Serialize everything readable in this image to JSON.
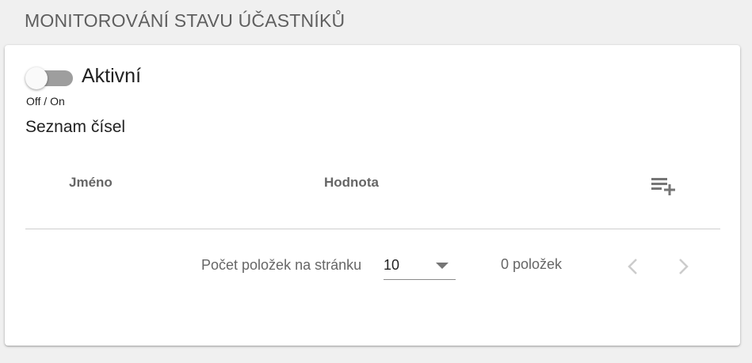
{
  "header": {
    "title": "MONITOROVÁNÍ STAVU ÚČASTNÍKŮ"
  },
  "toggle": {
    "label": "Aktivní",
    "hint": "Off / On",
    "checked": false
  },
  "numbers_section": {
    "title": "Seznam čísel"
  },
  "table": {
    "columns": [
      "Jméno",
      "Hodnota"
    ],
    "rows": [],
    "add_icon": "playlist-add-icon"
  },
  "paginator": {
    "items_per_page_label": "Počet položek na stránku",
    "page_size": "10",
    "range_label": "0 položek",
    "prev_icon": "chevron-left-icon",
    "next_icon": "chevron-right-icon"
  },
  "colors": {
    "background": "#f0f0f0",
    "card": "#ffffff",
    "toggle_track": "#9e9e9e",
    "muted_text": "#666666",
    "disabled_icon": "#cccccc"
  }
}
